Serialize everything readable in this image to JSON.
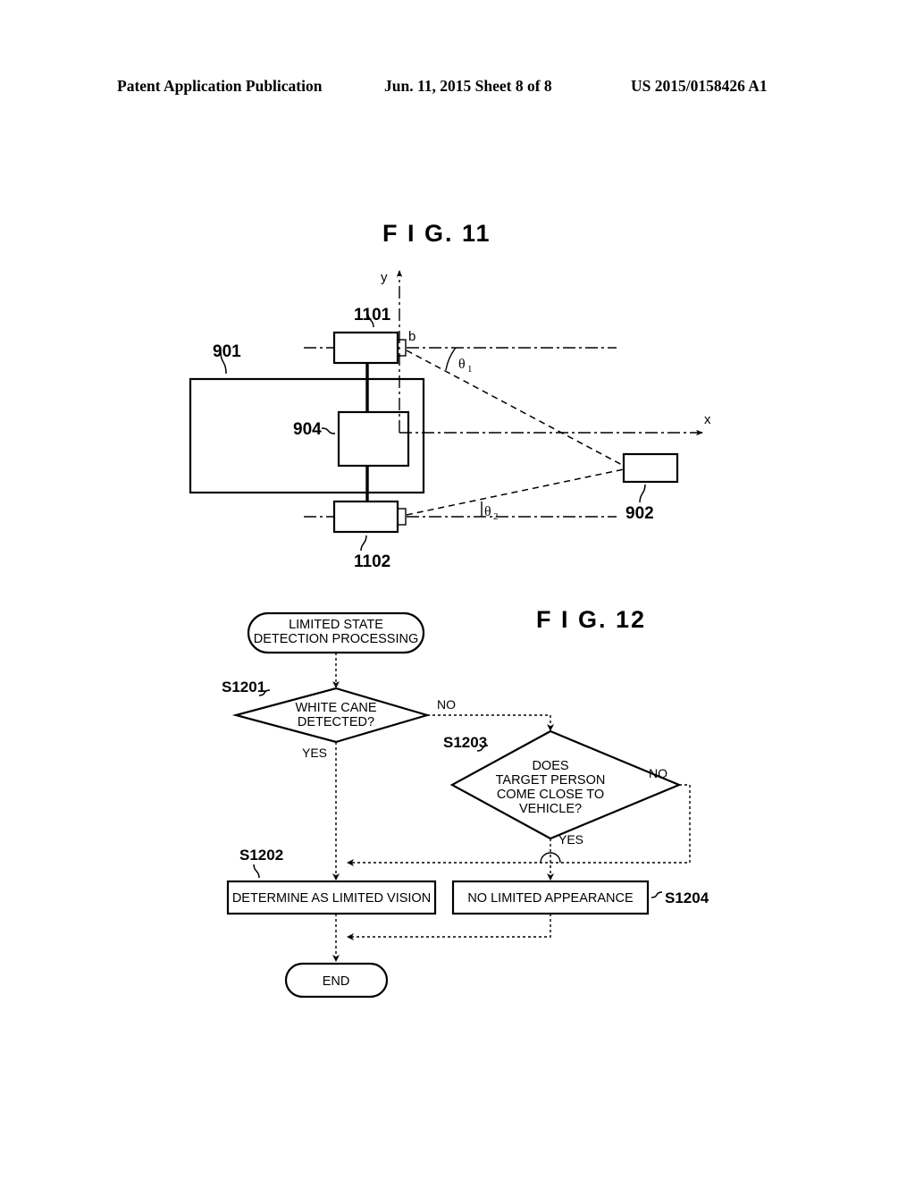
{
  "header": {
    "left": "Patent Application Publication",
    "middle": "Jun. 11, 2015  Sheet 8 of 8",
    "right": "US 2015/0158426 A1"
  },
  "fig11": {
    "title": "F I G. 11",
    "labels": {
      "vehicle": "901",
      "target": "902",
      "ecu": "904",
      "camera_front": "1101",
      "camera_rear": "1102",
      "point_b": "b",
      "axis_x": "x",
      "axis_y": "y",
      "theta1": "θ",
      "theta1_sub": "1",
      "theta2": "θ",
      "theta2_sub": "2"
    }
  },
  "fig12": {
    "title": "F I G. 12",
    "nodes": {
      "start_line1": "LIMITED STATE",
      "start_line2": "DETECTION PROCESSING",
      "d1_line1": "WHITE CANE",
      "d1_line2": "DETECTED?",
      "d2_line1": "DOES",
      "d2_line2": "TARGET PERSON",
      "d2_line3": "COME CLOSE TO",
      "d2_line4": "VEHICLE?",
      "p1": "DETERMINE AS LIMITED VISION",
      "p2": "NO LIMITED APPEARANCE",
      "end": "END"
    },
    "step_labels": {
      "s1201": "S1201",
      "s1202": "S1202",
      "s1203": "S1203",
      "s1204": "S1204"
    },
    "branches": {
      "d1_no": "NO",
      "d1_yes": "YES",
      "d2_no": "NO",
      "d2_yes": "YES"
    }
  },
  "colors": {
    "ink": "#000000",
    "paper": "#ffffff"
  }
}
